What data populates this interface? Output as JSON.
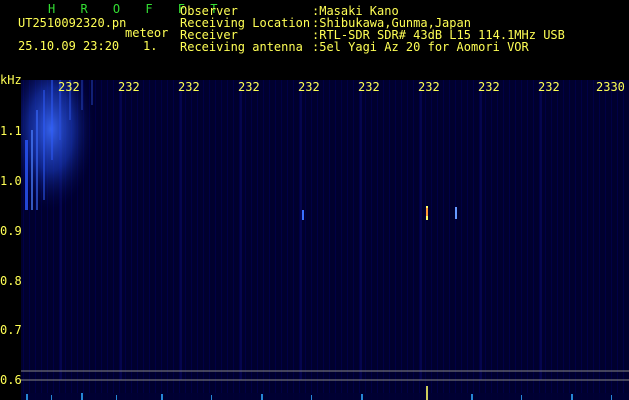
{
  "header": {
    "title": "H R O F F T",
    "filename": "UT2510092320.pn",
    "meteor_label": "meteor",
    "datetime": "25.10.09 23:20",
    "flag": "1.",
    "fields": [
      {
        "label": "Observer",
        "value": ":Masaki Kano"
      },
      {
        "label": "Receiving Location",
        "value": ":Shibukawa,Gunma,Japan"
      },
      {
        "label": "Receiver",
        "value": ":RTL-SDR SDR# 43dB L15 114.1MHz USB"
      },
      {
        "label": "Receiving antenna",
        "value": ":5el Yagi Az 20 for Aomori VOR"
      }
    ]
  },
  "axis": {
    "y_unit": "kHz",
    "y_ticks": [
      "1.1",
      "1.0",
      "0.9",
      "0.8",
      "0.7",
      "0.6"
    ],
    "x_ticks": [
      "232",
      "232",
      "232",
      "232",
      "232",
      "232",
      "232",
      "232",
      "232",
      "2330"
    ]
  },
  "colors": {
    "text": "#ffff55",
    "title": "#33dd33",
    "background": "#000000",
    "spectrogram_bg": "#000033"
  }
}
